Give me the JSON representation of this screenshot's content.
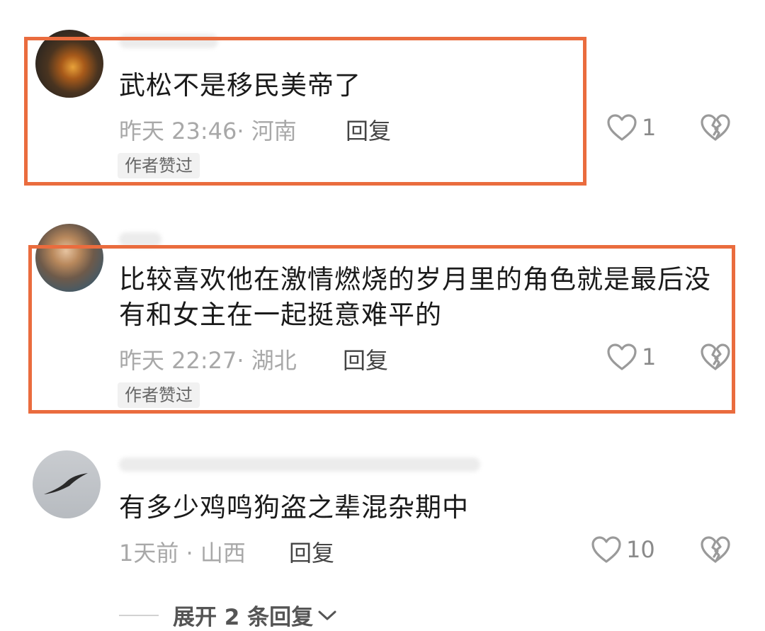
{
  "comments": [
    {
      "text": "武松不是移民美帝了",
      "meta": "昨天 23:46· 河南",
      "reply_label": "回复",
      "badge": "作者赞过",
      "likes": "1",
      "highlighted": true
    },
    {
      "text": "比较喜欢他在激情燃烧的岁月里的角色就是最后没有和女主在一起挺意难平的",
      "meta": "昨天 22:27· 湖北",
      "reply_label": "回复",
      "badge": "作者赞过",
      "likes": "1",
      "highlighted": true
    },
    {
      "text": "有多少鸡鸣狗盗之辈混杂期中",
      "meta": "1天前 · 山西",
      "reply_label": "回复",
      "likes": "10",
      "highlighted": false
    }
  ],
  "expand_label": "展开 2 条回复",
  "icons": {
    "like": "heart-outline-icon",
    "dislike": "broken-heart-icon",
    "expand": "chevron-down-icon"
  },
  "colors": {
    "highlight_border": "#ea6c3e",
    "meta_text": "#a8a8a8"
  }
}
